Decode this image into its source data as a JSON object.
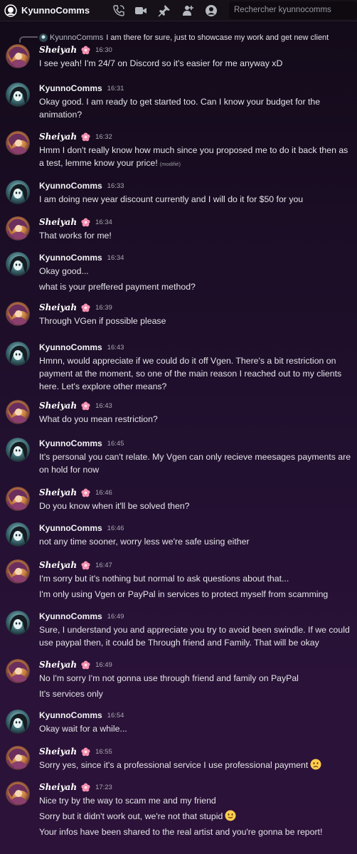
{
  "header": {
    "channel": "KyunnoComms",
    "search_placeholder": "Rechercher kyunnocomms"
  },
  "reply": {
    "author": "KyunnoComms",
    "text": "I am there for sure, just to showcase my work and get new client"
  },
  "messages": [
    {
      "author": "Sheiyah",
      "time": "16:30",
      "lines": [
        "I see yeah! I'm 24/7 on Discord so it's easier for me anyway xD"
      ]
    },
    {
      "author": "KyunnoComms",
      "time": "16:31",
      "lines": [
        "Okay good. I am ready to get started too. Can I know your budget for the",
        "animation?"
      ]
    },
    {
      "author": "Sheiyah",
      "time": "16:32",
      "lines": [
        "Hmm I don't really know how much since you proposed me to do it back then as",
        "a test, lemme know your price!"
      ],
      "edited": "(modifié)"
    },
    {
      "author": "KyunnoComms",
      "time": "16:33",
      "lines": [
        "I am doing new year discount currently and I will do it for $50 for you"
      ]
    },
    {
      "author": "Sheiyah",
      "time": "16:34",
      "lines": [
        "That works for me!"
      ]
    },
    {
      "author": "KyunnoComms",
      "time": "16:34",
      "lines": [
        "Okay good...",
        "what is your preffered payment method?"
      ]
    },
    {
      "author": "Sheiyah",
      "time": "16:39",
      "lines": [
        "Through VGen if possible please"
      ]
    },
    {
      "author": "KyunnoComms",
      "time": "16:43",
      "lines": [
        "Hmnn, would appreciate if we could do it off Vgen. There's a bit restriction on",
        "payment at the moment, so one of the main reason I reached out to my clients",
        "here. Let's explore other means?"
      ]
    },
    {
      "author": "Sheiyah",
      "time": "16:43",
      "lines": [
        "What do you mean restriction?"
      ]
    },
    {
      "author": "KyunnoComms",
      "time": "16:45",
      "lines": [
        "It's personal you can't relate. My Vgen can only recieve meesages payments are",
        "on hold for now"
      ]
    },
    {
      "author": "Sheiyah",
      "time": "16:46",
      "lines": [
        "Do you know when it'll be solved then?"
      ]
    },
    {
      "author": "KyunnoComms",
      "time": "16:46",
      "lines": [
        "not any time sooner, worry less we're safe using either"
      ]
    },
    {
      "author": "Sheiyah",
      "time": "16:47",
      "lines": [
        "I'm sorry but it's nothing but normal to ask questions about that...",
        "I'm only using Vgen or PayPal in services to protect myself from scamming"
      ]
    },
    {
      "author": "KyunnoComms",
      "time": "16:49",
      "lines": [
        "Sure, I understand you and appreciate you try to avoid been swindle. If we could",
        "use paypal then, it could be Through friend and Family. That will be okay"
      ]
    },
    {
      "author": "Sheiyah",
      "time": "16:49",
      "lines": [
        "No I'm sorry I'm not gonna use through friend and family on PayPal",
        "It's services only"
      ]
    },
    {
      "author": "KyunnoComms",
      "time": "16:54",
      "lines": [
        "Okay wait for a while..."
      ]
    },
    {
      "author": "Sheiyah",
      "time": "16:55",
      "lines": [
        "Sorry yes, since it's a professional service I use professional payment"
      ],
      "emoji": "frowning-face"
    },
    {
      "author": "Sheiyah",
      "time": "17:23",
      "lines": [
        "Nice try by the way to scam me and my friend",
        "Sorry but it didn't work out, we're not that stupid",
        "Your infos have been shared to the real artist and you're gonna be report!"
      ],
      "emoji_line": 1,
      "emoji": "slightly-smiling-face"
    }
  ]
}
